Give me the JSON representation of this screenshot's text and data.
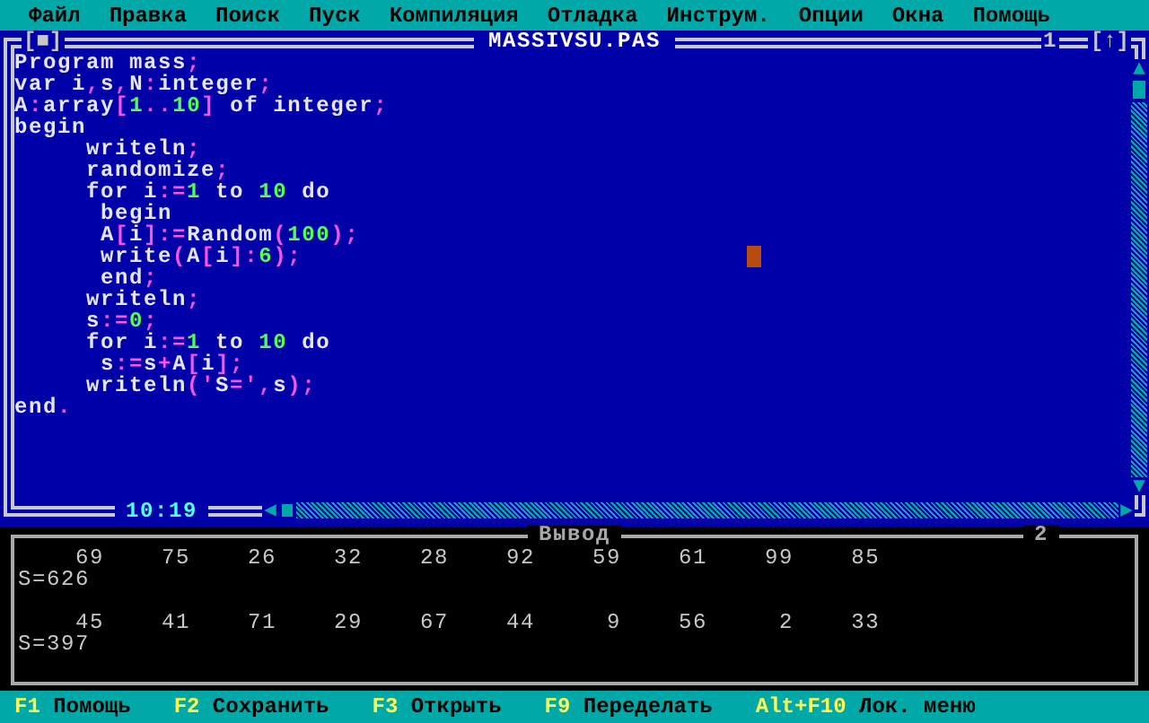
{
  "menu_bar": {
    "items": [
      "Файл",
      "Правка",
      "Поиск",
      "Пуск",
      "Компиляция",
      "Отладка",
      "Инструм.",
      "Опции",
      "Окна",
      "Помощь"
    ]
  },
  "editor": {
    "title": "MASSIVSU.PAS",
    "close_button": "[■]",
    "window_number": "1",
    "zoom_button": "[↑]",
    "position": "10:19",
    "lines": [
      "Program mass;",
      "var i,s,N:integer;",
      "A:array[1..10] of integer;",
      "begin",
      "     writeln;",
      "     randomize;",
      "     for i:=1 to 10 do",
      "      begin",
      "      A[i]:=Random(100);",
      "      write(A[i]:6);",
      "      end;",
      "     writeln;",
      "     s:=0;",
      "     for i:=1 to 10 do",
      "      s:=s+A[i];",
      "     writeln('S=',s);",
      "end."
    ]
  },
  "output": {
    "title": "Вывод",
    "window_number": "2",
    "runs": [
      {
        "values": "    69    75    26    32    28    92    59    61    99    85",
        "sum": "S=626"
      },
      {
        "values": "    45    41    71    29    67    44     9    56     2    33",
        "sum": "S=397"
      }
    ]
  },
  "status_bar": {
    "items": [
      {
        "key": "F1",
        "label": "Помощь"
      },
      {
        "key": "F2",
        "label": "Сохранить"
      },
      {
        "key": "F3",
        "label": "Открыть"
      },
      {
        "key": "F9",
        "label": "Переделать"
      },
      {
        "key": "Alt+F10",
        "label": "Лок. меню"
      }
    ]
  }
}
